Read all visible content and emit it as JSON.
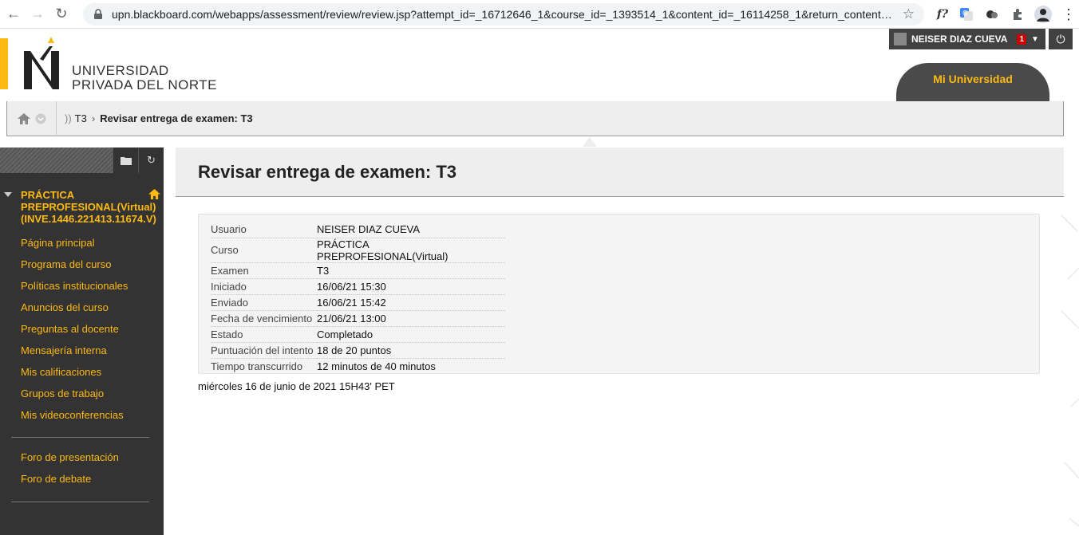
{
  "browser": {
    "url": "upn.blackboard.com/webapps/assessment/review/review.jsp?attempt_id=_16712646_1&course_id=_1393514_1&content_id=_16114258_1&return_content=...",
    "ext_formula": "f?"
  },
  "header": {
    "logo_line1": "UNIVERSIDAD",
    "logo_line2": "PRIVADA DEL NORTE",
    "user_name": "NEISER DIAZ CUEVA",
    "notification_count": "1",
    "mi_universidad": "Mi Universidad"
  },
  "breadcrumb": {
    "prefix": "))",
    "item1": "T3",
    "separator": "›",
    "current": "Revisar entrega de examen: T3"
  },
  "sidebar": {
    "course_title": "PRÁCTICA PREPROFESIONAL(Virtual) (INVE.1446.221413.11674.V)",
    "items": [
      {
        "label": "Página principal"
      },
      {
        "label": "Programa del curso"
      },
      {
        "label": "Políticas institucionales"
      },
      {
        "label": "Anuncios del curso"
      },
      {
        "label": "Preguntas al docente"
      },
      {
        "label": "Mensajería interna"
      },
      {
        "label": "Mis calificaciones"
      },
      {
        "label": "Grupos de trabajo"
      },
      {
        "label": "Mis videoconferencias"
      }
    ],
    "items2": [
      {
        "label": "Foro de presentación"
      },
      {
        "label": "Foro de debate"
      }
    ]
  },
  "page": {
    "title": "Revisar entrega de examen: T3",
    "details": [
      {
        "label": "Usuario",
        "value": "NEISER DIAZ CUEVA"
      },
      {
        "label": "Curso",
        "value": "PRÁCTICA PREPROFESIONAL(Virtual)"
      },
      {
        "label": "Examen",
        "value": "T3"
      },
      {
        "label": "Iniciado",
        "value": "16/06/21 15:30"
      },
      {
        "label": "Enviado",
        "value": "16/06/21 15:42"
      },
      {
        "label": "Fecha de vencimiento",
        "value": "21/06/21 13:00"
      },
      {
        "label": "Estado",
        "value": "Completado"
      },
      {
        "label": "Puntuación del intento",
        "value": "18 de 20 puntos"
      },
      {
        "label": "Tiempo transcurrido",
        "value": "12 minutos de 40 minutos"
      }
    ],
    "timestamp": "miércoles 16 de junio de 2021 15H43' PET"
  },
  "colors": {
    "accent": "#fdb913",
    "sidebar_bg": "#333333",
    "header_bg": "#eeeeee"
  }
}
